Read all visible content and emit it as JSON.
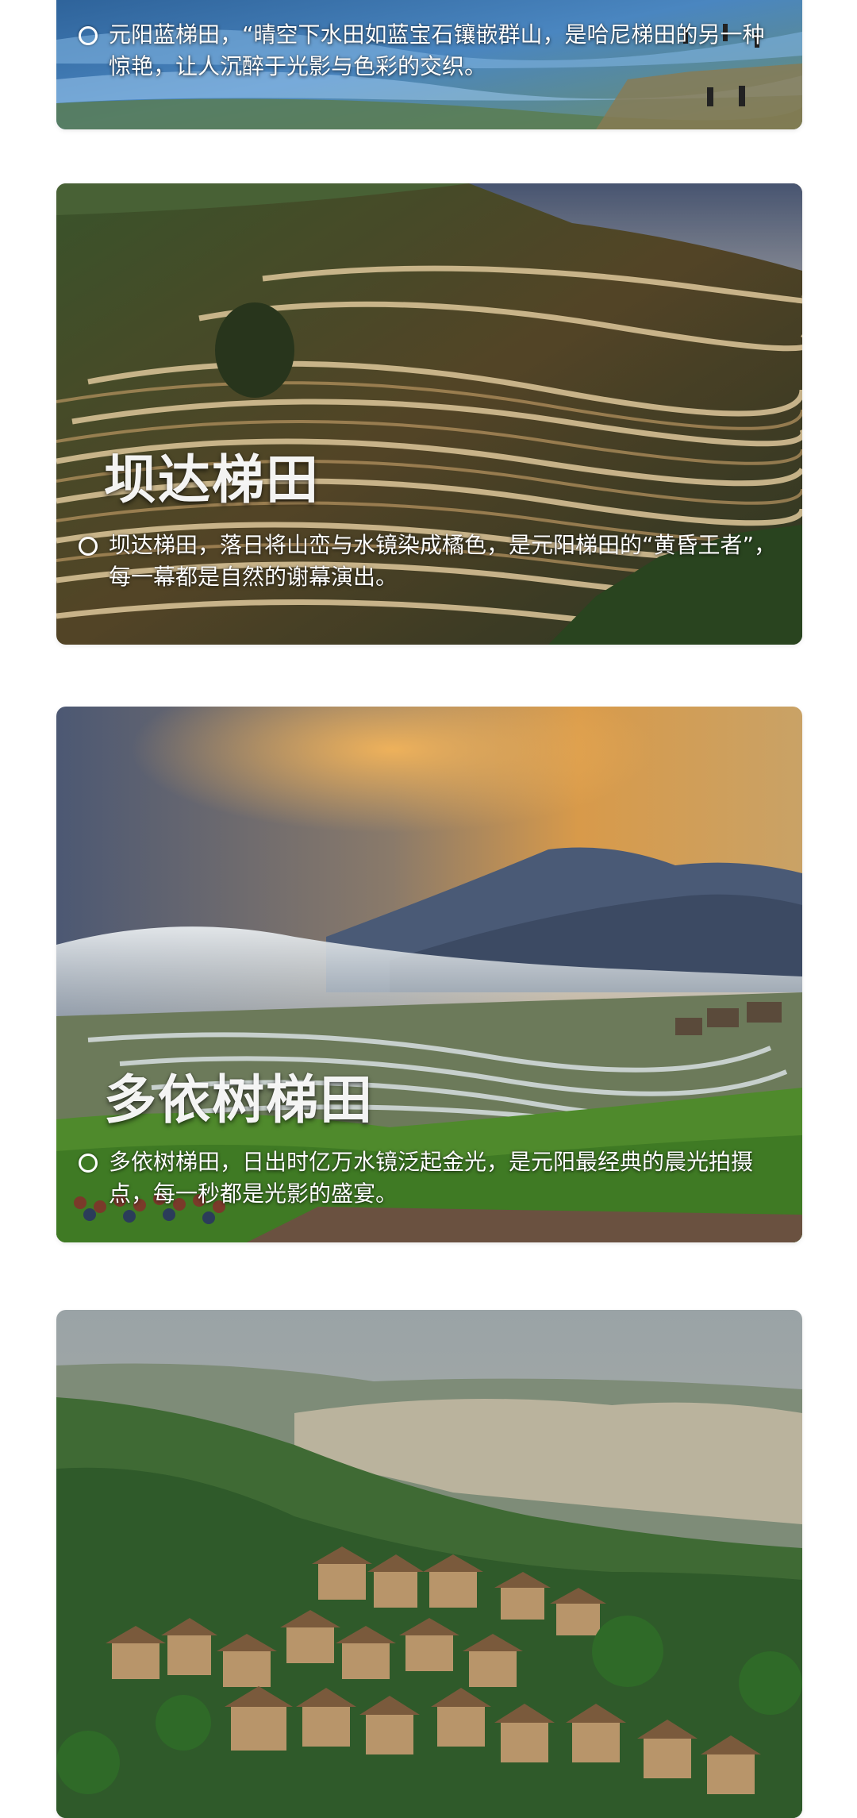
{
  "cards": [
    {
      "title": "",
      "description": "元阳蓝梯田，“晴空下水田如蓝宝石镶嵌群山，是哈尼梯田的另一种惊艳，让人沉醉于光影与色彩的交织。",
      "image": "blue-terraced-fields-photo"
    },
    {
      "title": "坝达梯田",
      "description": "坝达梯田，落日将山峦与水镜染成橘色，是元阳梯田的“黄昏王者”，每一幕都是自然的谢幕演出。",
      "image": "bada-terraces-sunset-photo"
    },
    {
      "title": "多依树梯田",
      "description": "多依树梯田，日出时亿万水镜泛起金光，是元阳最经典的晨光拍摄点，每一秒都是光影的盛宴。",
      "image": "duoyishu-terraces-sunrise-photo"
    },
    {
      "title": "",
      "description": "",
      "image": "mushroom-house-village-photo"
    }
  ],
  "colors": {
    "background": "#ffffff",
    "text": "#ffffff"
  }
}
